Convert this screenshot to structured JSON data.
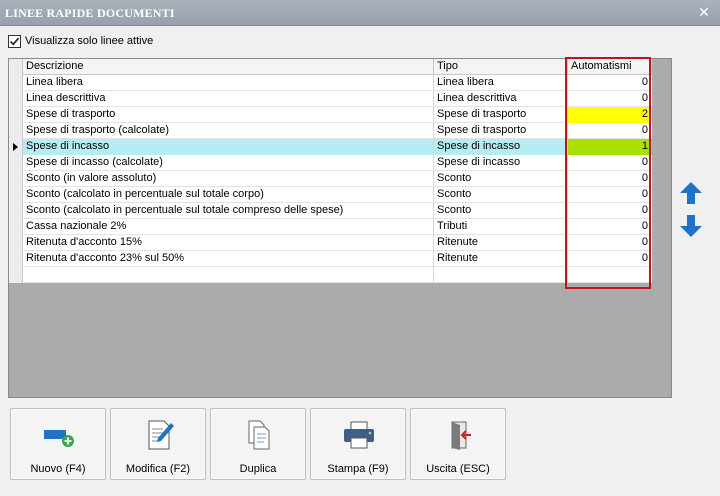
{
  "window": {
    "title": "LINEE RAPIDE DOCUMENTI",
    "close_glyph": "✕"
  },
  "filter": {
    "label": "Visualizza solo linee attive",
    "checked": true
  },
  "grid": {
    "columns": [
      "Descrizione",
      "Tipo",
      "Automatismi"
    ],
    "rows": [
      {
        "descrizione": "Linea libera",
        "tipo": "Linea libera",
        "automatismi": "0",
        "highlight": ""
      },
      {
        "descrizione": "Linea descrittiva",
        "tipo": "Linea descrittiva",
        "automatismi": "0",
        "highlight": ""
      },
      {
        "descrizione": "Spese di trasporto",
        "tipo": "Spese di trasporto",
        "automatismi": "2",
        "highlight": "#ffff00"
      },
      {
        "descrizione": "Spese di trasporto (calcolate)",
        "tipo": "Spese di trasporto",
        "automatismi": "0",
        "highlight": ""
      },
      {
        "descrizione": "Spese di incasso",
        "tipo": "Spese di incasso",
        "automatismi": "1",
        "highlight": "#a8e000",
        "selected": true
      },
      {
        "descrizione": "Spese di incasso (calcolate)",
        "tipo": "Spese di incasso",
        "automatismi": "0",
        "highlight": ""
      },
      {
        "descrizione": "Sconto (in valore assoluto)",
        "tipo": "Sconto",
        "automatismi": "0",
        "highlight": ""
      },
      {
        "descrizione": "Sconto (calcolato in percentuale sul totale corpo)",
        "tipo": "Sconto",
        "automatismi": "0",
        "highlight": ""
      },
      {
        "descrizione": "Sconto (calcolato in percentuale sul totale compreso delle spese)",
        "tipo": "Sconto",
        "automatismi": "0",
        "highlight": ""
      },
      {
        "descrizione": "Cassa nazionale 2%",
        "tipo": "Tributi",
        "automatismi": "0",
        "highlight": ""
      },
      {
        "descrizione": "Ritenuta d'acconto 15%",
        "tipo": "Ritenute",
        "automatismi": "0",
        "highlight": ""
      },
      {
        "descrizione": "Ritenuta d'acconto 23% sul 50%",
        "tipo": "Ritenute",
        "automatismi": "0",
        "highlight": ""
      },
      {
        "descrizione": "",
        "tipo": "",
        "automatismi": "",
        "highlight": ""
      }
    ]
  },
  "side_buttons": [
    {
      "name": "move-up-button",
      "icon": "arrow-up-icon"
    },
    {
      "name": "move-down-button",
      "icon": "arrow-down-icon"
    }
  ],
  "toolbar": {
    "buttons": [
      {
        "name": "nuovo-button",
        "label": "Nuovo (F4)",
        "icon": "new-line-icon"
      },
      {
        "name": "modifica-button",
        "label": "Modifica (F2)",
        "icon": "edit-document-icon"
      },
      {
        "name": "duplica-button",
        "label": "Duplica",
        "icon": "duplicate-icon"
      },
      {
        "name": "stampa-button",
        "label": "Stampa (F9)",
        "icon": "printer-icon"
      },
      {
        "name": "uscita-button",
        "label": "Uscita (ESC)",
        "icon": "exit-door-icon"
      }
    ]
  },
  "colors": {
    "accent_blue": "#1e72c8",
    "frame_red": "#c0141c",
    "selected_row": "#b6ecf2"
  }
}
